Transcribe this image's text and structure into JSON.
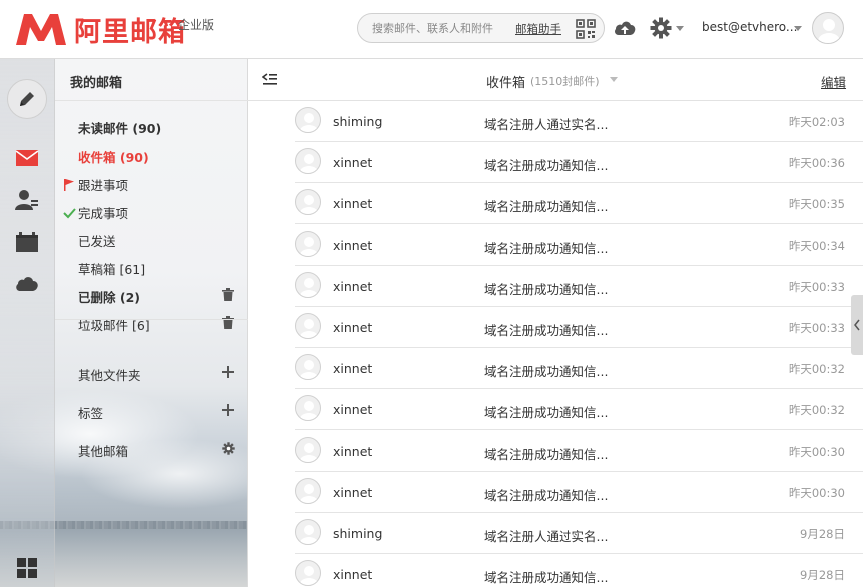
{
  "app": {
    "logo_text": "阿里邮箱",
    "edition": "企业版",
    "brand_color": "#e8403b"
  },
  "header": {
    "search_placeholder": "搜索邮件、联系人和附件",
    "mail_helper": "邮箱助手",
    "qr_icon": "qr-code-icon",
    "cloud_icon": "cloud-upload-icon",
    "settings_icon": "gear-icon",
    "user_email": "best@etvhero..."
  },
  "rail": {
    "compose_icon": "pencil-icon",
    "items": [
      "mail-icon",
      "contacts-icon",
      "calendar-icon",
      "cloud-icon"
    ],
    "apps_icon": "grid-icon"
  },
  "folders": {
    "title": "我的邮箱",
    "unread": "未读邮件 (90)",
    "inbox": "收件箱 (90)",
    "follow_up": "跟进事项",
    "done": "完成事项",
    "sent": "已发送",
    "drafts": "草稿箱 [61]",
    "deleted": "已删除 (2)",
    "spam": "垃圾邮件 [6]",
    "other_folders": "其他文件夹",
    "tags": "标签",
    "other_mailboxes": "其他邮箱"
  },
  "list": {
    "title": "收件箱",
    "count": "(1510封邮件)",
    "edit": "编辑",
    "rows": [
      {
        "sender": "shiming",
        "subject": "域名注册人通过实名...",
        "date": "昨天02:03"
      },
      {
        "sender": "xinnet",
        "subject": "域名注册成功通知信...",
        "date": "昨天00:36"
      },
      {
        "sender": "xinnet",
        "subject": "域名注册成功通知信...",
        "date": "昨天00:35"
      },
      {
        "sender": "xinnet",
        "subject": "域名注册成功通知信...",
        "date": "昨天00:34"
      },
      {
        "sender": "xinnet",
        "subject": "域名注册成功通知信...",
        "date": "昨天00:33"
      },
      {
        "sender": "xinnet",
        "subject": "域名注册成功通知信...",
        "date": "昨天00:33"
      },
      {
        "sender": "xinnet",
        "subject": "域名注册成功通知信...",
        "date": "昨天00:32"
      },
      {
        "sender": "xinnet",
        "subject": "域名注册成功通知信...",
        "date": "昨天00:32"
      },
      {
        "sender": "xinnet",
        "subject": "域名注册成功通知信...",
        "date": "昨天00:30"
      },
      {
        "sender": "xinnet",
        "subject": "域名注册成功通知信...",
        "date": "昨天00:30"
      },
      {
        "sender": "shiming",
        "subject": "域名注册人通过实名...",
        "date": "9月28日"
      },
      {
        "sender": "xinnet",
        "subject": "域名注册成功通知信...",
        "date": "9月28日"
      }
    ]
  }
}
